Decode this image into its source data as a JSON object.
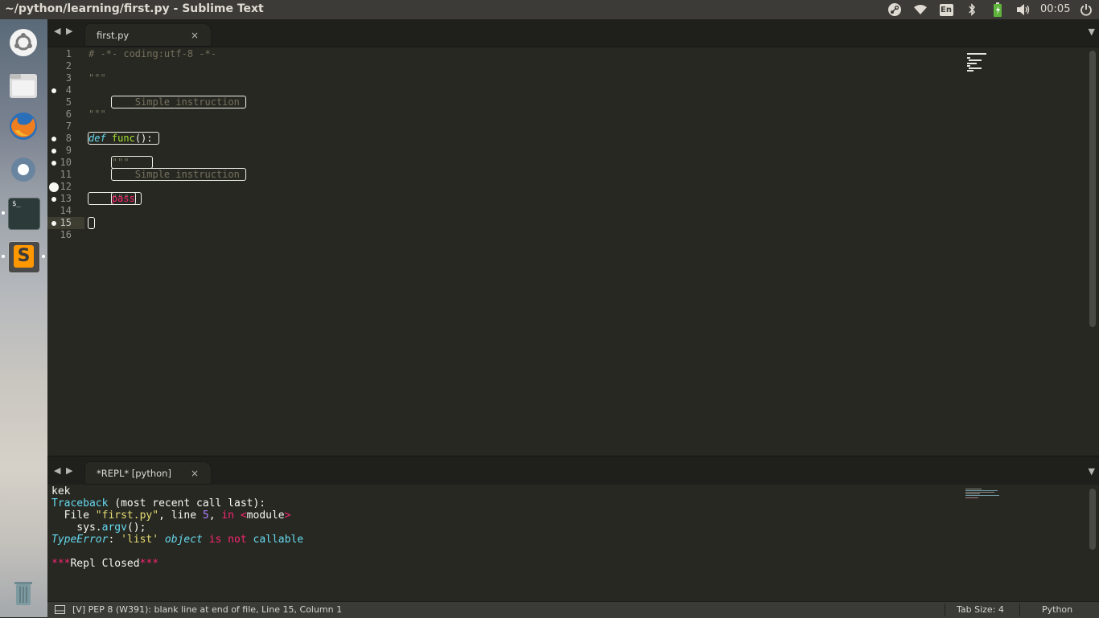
{
  "window": {
    "title": "~/python/learning/first.py - Sublime Text"
  },
  "tray": {
    "keyboard_layout": "En",
    "clock": "00:05"
  },
  "launcher": {
    "items": [
      {
        "name": "dash",
        "label": ""
      },
      {
        "name": "files",
        "label": ""
      },
      {
        "name": "firefox",
        "label": ""
      },
      {
        "name": "chromium",
        "label": ""
      },
      {
        "name": "terminal",
        "label": "$_"
      },
      {
        "name": "sublime",
        "label": "S"
      },
      {
        "name": "trash",
        "label": ""
      }
    ]
  },
  "editor_tab": {
    "label": "first.py",
    "close": "×"
  },
  "repl_tab": {
    "label": "*REPL* [python]",
    "close": "×"
  },
  "nav": {
    "back": "◀",
    "forward": "▶",
    "menu": "▼"
  },
  "editor": {
    "line_numbers": [
      "1",
      "2",
      "3",
      "4",
      "5",
      "6",
      "7",
      "8",
      "9",
      "10",
      "11",
      "12",
      "13",
      "14",
      "15",
      "16"
    ],
    "lines": {
      "l1": "# -*- coding:utf-8 -*-",
      "l3": "\"\"\"",
      "l4": "    Simple instruction ",
      "l6": "\"\"\"",
      "l8_kw": "def",
      "l8_fn": "func",
      "l8_rest": "():",
      "l9": "\"\"\"    ",
      "l10": "    Simple instruction ",
      "l12": "\"\"\" ",
      "l13_indent": "    ",
      "l13_kw": "pass"
    }
  },
  "repl": {
    "l1": "kek",
    "l2_a": "Traceback",
    "l2_b": " (most recent call last):",
    "l3_a": "  File ",
    "l3_b": "\"first.py\"",
    "l3_c": ", line ",
    "l3_d": "5",
    "l3_e": ", ",
    "l3_f": "in",
    "l3_g": " <",
    "l3_h": "module",
    "l3_i": ">",
    "l4_a": "    sys.",
    "l4_b": "argv",
    "l4_c": "();",
    "l5_a": "TypeError",
    "l5_b": ": ",
    "l5_c": "'list'",
    "l5_d": " ",
    "l5_e": "object",
    "l5_f": " ",
    "l5_g": "is not",
    "l5_h": " ",
    "l5_i": "callable",
    "l7_a": "***",
    "l7_b": "Repl Closed",
    "l7_c": "***"
  },
  "status": {
    "message": "[V] PEP 8 (W391): blank line at end of file, Line 15, Column 1",
    "tab_size": "Tab Size: 4",
    "syntax": "Python"
  },
  "colors": {
    "editor_bg": "#272822",
    "comment": "#75715e",
    "keyword": "#66d9ef",
    "function": "#a6e22e",
    "string": "#e6db74",
    "number": "#ae81ff",
    "pink": "#f92672"
  }
}
